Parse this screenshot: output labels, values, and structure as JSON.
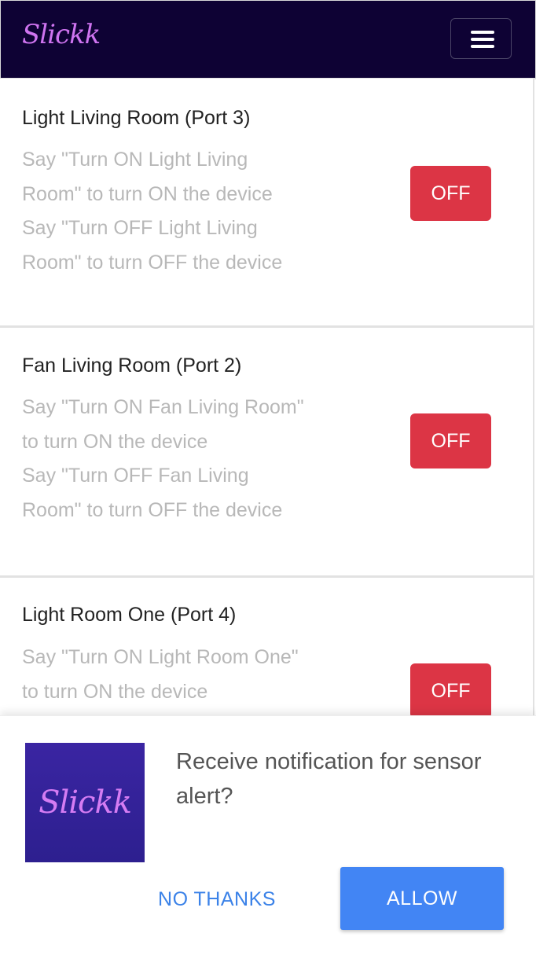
{
  "header": {
    "brand": "Slickk",
    "menu_icon": "hamburger-menu-icon"
  },
  "devices": [
    {
      "title": "Light Living Room (Port 3)",
      "desc_lines": [
        "Say \"Turn ON Light Living",
        "Room\" to turn ON the device",
        "Say \"Turn OFF Light Living",
        "Room\" to turn OFF the device"
      ],
      "state": "OFF"
    },
    {
      "title": "Fan Living Room (Port 2)",
      "desc_lines": [
        "Say \"Turn ON Fan Living Room\"",
        "to turn ON the device",
        "Say \"Turn OFF Fan Living",
        "Room\" to turn OFF the device"
      ],
      "state": "OFF"
    },
    {
      "title": "Light Room One (Port 4)",
      "desc_lines": [
        "Say \"Turn ON Light Room One\"",
        "to turn ON the device"
      ],
      "state": "OFF"
    }
  ],
  "notification_prompt": {
    "logo_text": "Slickk",
    "message": "Receive notification for sensor alert?",
    "decline_label": "NO THANKS",
    "accept_label": "ALLOW"
  },
  "colors": {
    "navbar_bg": "#0e0234",
    "brand": "#cf74f0",
    "off_button": "#dc3545",
    "allow_button": "#4285f4",
    "decline_text": "#3b82e8"
  }
}
